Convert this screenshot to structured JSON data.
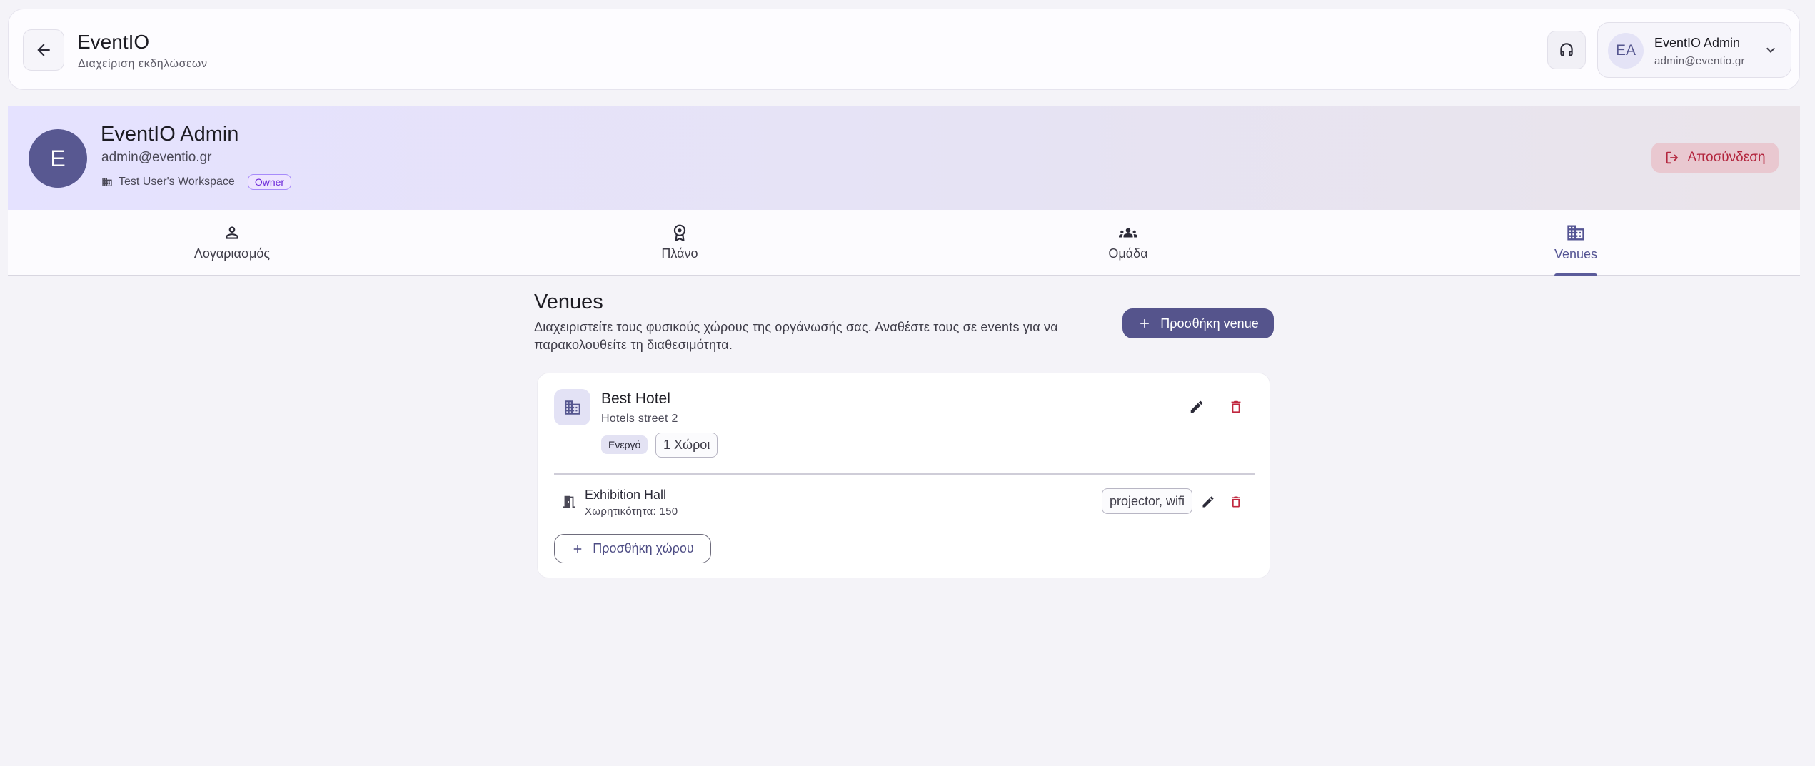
{
  "header": {
    "title": "EventIO",
    "subtitle": "Διαχείριση εκδηλώσεων",
    "user": {
      "initials": "EA",
      "name": "EventIO Admin",
      "email": "admin@eventio.gr"
    }
  },
  "profile": {
    "initial": "E",
    "name": "EventIO Admin",
    "email": "admin@eventio.gr",
    "workspace": "Test User's Workspace",
    "role_badge": "Owner",
    "logout_label": "Αποσύνδεση"
  },
  "tabs": [
    {
      "label": "Λογαριασμός",
      "icon": "person-icon"
    },
    {
      "label": "Πλάνο",
      "icon": "award-icon"
    },
    {
      "label": "Ομάδα",
      "icon": "group-icon"
    },
    {
      "label": "Venues",
      "icon": "building-icon",
      "active": true
    }
  ],
  "venues_page": {
    "title": "Venues",
    "description": "Διαχειριστείτε τους φυσικούς χώρους της οργάνωσής σας. Αναθέστε τους σε events για να παρακολουθείτε τη διαθεσιμότητα.",
    "add_venue_label": "Προσθήκη venue",
    "venues": [
      {
        "name": "Best Hotel",
        "address": "Hotels street 2",
        "status": "Ενεργό",
        "rooms_count_label": "1 Χώροι",
        "rooms": [
          {
            "name": "Exhibition Hall",
            "capacity_label": "Χωρητικότητα: 150",
            "amenities": "projector, wifi"
          }
        ],
        "add_room_label": "Προσθήκη χώρου"
      }
    ]
  },
  "colors": {
    "accent": "#55548c",
    "danger": "#c0263e",
    "banner_start": "#e5e2ff",
    "banner_end": "#eae4ea"
  }
}
